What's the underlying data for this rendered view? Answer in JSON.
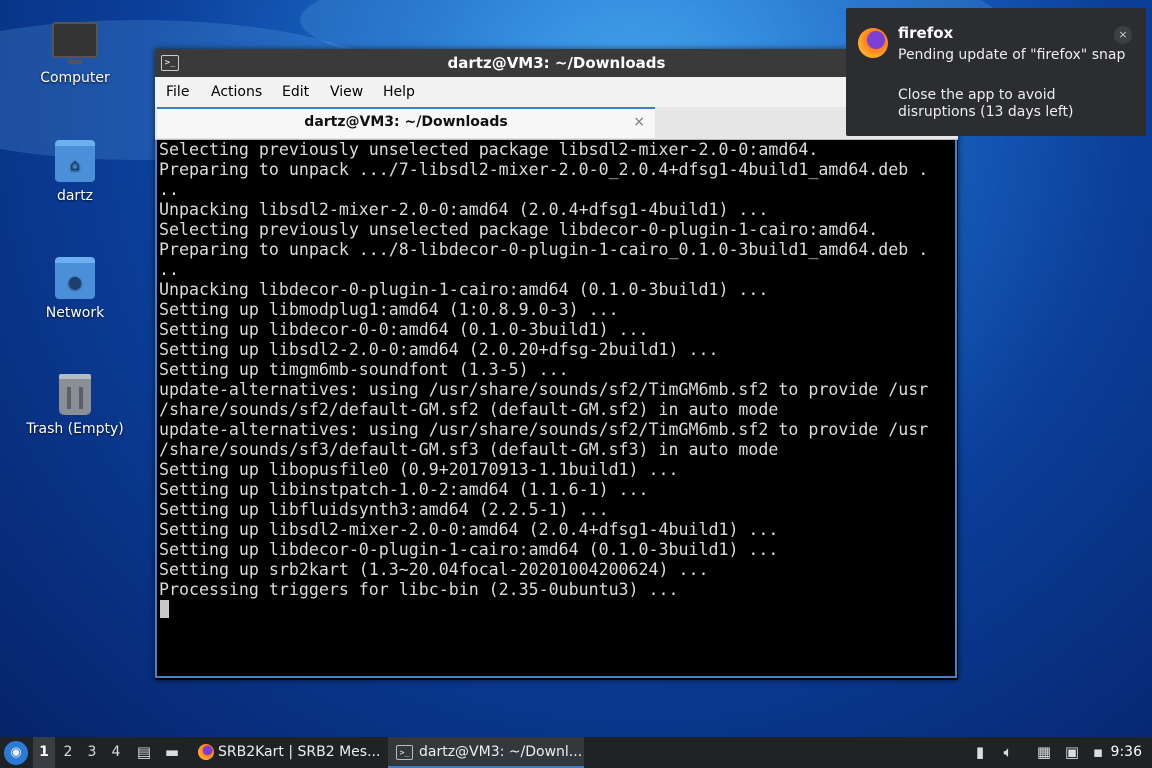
{
  "desktop": {
    "icons": [
      {
        "label": "Computer"
      },
      {
        "label": "dartz"
      },
      {
        "label": "Network"
      },
      {
        "label": "Trash (Empty)"
      }
    ]
  },
  "terminal": {
    "window_title": "dartz@VM3: ~/Downloads",
    "menu": [
      "File",
      "Actions",
      "Edit",
      "View",
      "Help"
    ],
    "tab_title": "dartz@VM3: ~/Downloads",
    "tab_close": "×",
    "lines": [
      "Selecting previously unselected package libsdl2-mixer-2.0-0:amd64.",
      "Preparing to unpack .../7-libsdl2-mixer-2.0-0_2.0.4+dfsg1-4build1_amd64.deb .",
      "..",
      "Unpacking libsdl2-mixer-2.0-0:amd64 (2.0.4+dfsg1-4build1) ...",
      "Selecting previously unselected package libdecor-0-plugin-1-cairo:amd64.",
      "Preparing to unpack .../8-libdecor-0-plugin-1-cairo_0.1.0-3build1_amd64.deb .",
      "..",
      "Unpacking libdecor-0-plugin-1-cairo:amd64 (0.1.0-3build1) ...",
      "Setting up libmodplug1:amd64 (1:0.8.9.0-3) ...",
      "Setting up libdecor-0-0:amd64 (0.1.0-3build1) ...",
      "Setting up libsdl2-2.0-0:amd64 (2.0.20+dfsg-2build1) ...",
      "Setting up timgm6mb-soundfont (1.3-5) ...",
      "update-alternatives: using /usr/share/sounds/sf2/TimGM6mb.sf2 to provide /usr",
      "/share/sounds/sf2/default-GM.sf2 (default-GM.sf2) in auto mode",
      "update-alternatives: using /usr/share/sounds/sf2/TimGM6mb.sf2 to provide /usr",
      "/share/sounds/sf3/default-GM.sf3 (default-GM.sf3) in auto mode",
      "Setting up libopusfile0 (0.9+20170913-1.1build1) ...",
      "Setting up libinstpatch-1.0-2:amd64 (1.1.6-1) ...",
      "Setting up libfluidsynth3:amd64 (2.2.5-1) ...",
      "Setting up libsdl2-mixer-2.0-0:amd64 (2.0.4+dfsg1-4build1) ...",
      "Setting up libdecor-0-plugin-1-cairo:amd64 (0.1.0-3build1) ...",
      "Setting up srb2kart (1.3~20.04focal-20201004200624) ...",
      "Processing triggers for libc-bin (2.35-0ubuntu3) ..."
    ]
  },
  "notification": {
    "app": "firefox",
    "close": "×",
    "line1": "Pending update of \"firefox\" snap",
    "line2": "Close the app to avoid disruptions (13 days left)"
  },
  "taskbar": {
    "workspaces": [
      "1",
      "2",
      "3",
      "4"
    ],
    "active_workspace": "1",
    "tasks": [
      {
        "label": "SRB2Kart | SRB2 Mes..."
      },
      {
        "label": "dartz@VM3: ~/Downl..."
      }
    ],
    "clock": "9:36"
  },
  "colors": {
    "accent": "#3b7fc4",
    "terminal_bg": "#000000",
    "terminal_fg": "#dcdcdc",
    "taskbar_bg": "#202326",
    "notification_bg": "#2b2d30"
  }
}
